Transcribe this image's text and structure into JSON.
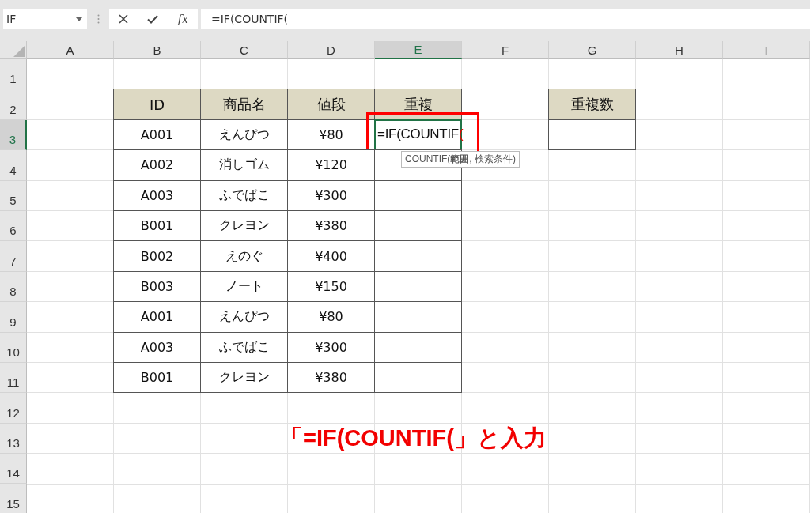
{
  "name_box": {
    "value": "IF"
  },
  "formula_bar": {
    "fx": "fx",
    "formula": "=IF(COUNTIF("
  },
  "columns": [
    {
      "label": "A",
      "selected": false
    },
    {
      "label": "B",
      "selected": false
    },
    {
      "label": "C",
      "selected": false
    },
    {
      "label": "D",
      "selected": false
    },
    {
      "label": "E",
      "selected": true
    },
    {
      "label": "F",
      "selected": false
    },
    {
      "label": "G",
      "selected": false
    },
    {
      "label": "H",
      "selected": false
    },
    {
      "label": "I",
      "selected": false
    }
  ],
  "rows": [
    {
      "label": "1",
      "selected": false
    },
    {
      "label": "2",
      "selected": false
    },
    {
      "label": "3",
      "selected": true
    },
    {
      "label": "4",
      "selected": false
    },
    {
      "label": "5",
      "selected": false
    },
    {
      "label": "6",
      "selected": false
    },
    {
      "label": "7",
      "selected": false
    },
    {
      "label": "8",
      "selected": false
    },
    {
      "label": "9",
      "selected": false
    },
    {
      "label": "10",
      "selected": false
    },
    {
      "label": "11",
      "selected": false
    },
    {
      "label": "12",
      "selected": false
    },
    {
      "label": "13",
      "selected": false
    },
    {
      "label": "14",
      "selected": false
    },
    {
      "label": "15",
      "selected": false
    }
  ],
  "table": {
    "columns": [
      "ID",
      "商品名",
      "値段",
      "重複"
    ],
    "rows": [
      [
        "A001",
        "えんぴつ",
        "¥80",
        ""
      ],
      [
        "A002",
        "消しゴム",
        "¥120",
        ""
      ],
      [
        "A003",
        "ふでばこ",
        "¥300",
        ""
      ],
      [
        "B001",
        "クレヨン",
        "¥380",
        ""
      ],
      [
        "B002",
        "えのぐ",
        "¥400",
        ""
      ],
      [
        "B003",
        "ノート",
        "¥150",
        ""
      ],
      [
        "A001",
        "えんぴつ",
        "¥80",
        ""
      ],
      [
        "A003",
        "ふでばこ",
        "¥300",
        ""
      ],
      [
        "B001",
        "クレヨン",
        "¥380",
        ""
      ]
    ]
  },
  "editing_cell": {
    "text": "=IF(COUNTIF",
    "open_paren": "("
  },
  "tooltip": "COUNTIF(**範囲**, 検索条件)",
  "count_table": {
    "header": "重複数"
  },
  "annotation": "「=IF(COUNTIF(」と入力"
}
